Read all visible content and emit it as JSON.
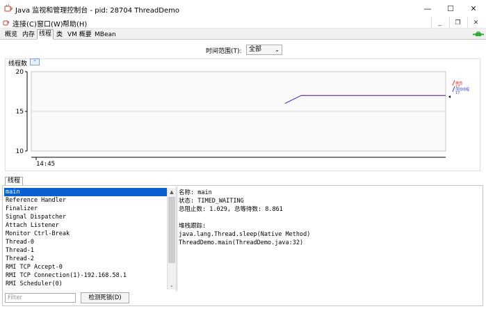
{
  "window": {
    "title": "Java 监视和管理控制台 - pid: 28704 ThreadDemo",
    "minimize_glyph": "—",
    "maximize_glyph": "☐",
    "close_glyph": "✕"
  },
  "menu": {
    "items": [
      "连接(C)",
      "窗口(W)",
      "帮助(H)"
    ],
    "mdi_minimize": "_",
    "mdi_restore": "❐",
    "mdi_close": "✕"
  },
  "tabs": [
    "概览",
    "内存",
    "线程",
    "类",
    "VM 概要",
    "MBean"
  ],
  "active_tab": "线程",
  "time_range": {
    "label": "时间范围(T):",
    "value": "全部",
    "arrow": "⌄"
  },
  "chart": {
    "title": "线程数",
    "collapse_glyph": "⌃",
    "legend": [
      {
        "name": "峰值",
        "value": "17",
        "color": "#e03030"
      },
      {
        "name": "活动线程",
        "value": "17",
        "color": "#3b3bd8"
      }
    ]
  },
  "chart_data": {
    "type": "line",
    "ylim": [
      10,
      20
    ],
    "yticks": [
      "10",
      "15",
      "20"
    ],
    "xticks": [
      "14:45"
    ],
    "series": [
      {
        "name": "峰值",
        "color": "#e03030",
        "x": [
          0,
          0.1,
          1
        ],
        "values": [
          16,
          17,
          17
        ]
      },
      {
        "name": "活动线程",
        "color": "#3b3bd8",
        "x": [
          0,
          0.1,
          1
        ],
        "values": [
          16,
          17,
          17
        ]
      }
    ]
  },
  "threads": {
    "tab_label": "线程",
    "list": [
      "main",
      "Reference Handler",
      "Finalizer",
      "Signal Dispatcher",
      "Attach Listener",
      "Monitor Ctrl-Break",
      "Thread-0",
      "Thread-1",
      "Thread-2",
      "RMI TCP Accept-0",
      "RMI TCP Connection(1)-192.168.58.1",
      "RMI Scheduler(0)"
    ],
    "selected": "main",
    "scroll_up": "▲",
    "scroll_down": "⌄",
    "details": [
      "名称: main",
      "状态: TIMED_WAITING",
      "总阻止数: 1.029, 总等待数: 8.861",
      "",
      "堆栈跟踪:",
      "java.lang.Thread.sleep(Native Method)",
      "ThreadDemo.main(ThreadDemo.java:32)"
    ],
    "filter_placeholder": "Filter",
    "deadlock_button": "检测死锁(D)"
  }
}
